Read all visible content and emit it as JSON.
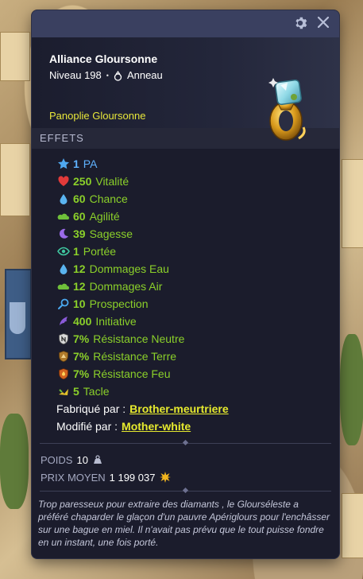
{
  "window": {
    "settings_icon": "gear-icon",
    "close_icon": "close-icon"
  },
  "item": {
    "name": "Alliance Gloursonne",
    "level": "Niveau 198",
    "separator": "•",
    "type": "Anneau",
    "set": "Panoplie Gloursonne"
  },
  "effects_title": "EFFETS",
  "effects": [
    {
      "value": "1",
      "label": "PA",
      "icon": "star-icon",
      "color": "#5fb2ff"
    },
    {
      "value": "250",
      "label": "Vitalité",
      "icon": "heart-icon",
      "color": "#8bd02a"
    },
    {
      "value": "60",
      "label": "Chance",
      "icon": "water-drop-icon",
      "color": "#8bd02a"
    },
    {
      "value": "60",
      "label": "Agilité",
      "icon": "air-cloud-icon",
      "color": "#8bd02a"
    },
    {
      "value": "39",
      "label": "Sagesse",
      "icon": "moon-icon",
      "color": "#8bd02a"
    },
    {
      "value": "1",
      "label": "Portée",
      "icon": "eye-icon",
      "color": "#8bd02a"
    },
    {
      "value": "12",
      "label": "Dommages Eau",
      "icon": "water-drop-icon",
      "color": "#8bd02a"
    },
    {
      "value": "12",
      "label": "Dommages Air",
      "icon": "air-cloud-icon",
      "color": "#8bd02a"
    },
    {
      "value": "10",
      "label": "Prospection",
      "icon": "magnifier-icon",
      "color": "#8bd02a"
    },
    {
      "value": "400",
      "label": "Initiative",
      "icon": "wing-icon",
      "color": "#8bd02a"
    },
    {
      "value": "7%",
      "label": "Résistance Neutre",
      "icon": "shield-neutral-icon",
      "color": "#8bd02a"
    },
    {
      "value": "7%",
      "label": "Résistance Terre",
      "icon": "shield-earth-icon",
      "color": "#8bd02a"
    },
    {
      "value": "7%",
      "label": "Résistance Feu",
      "icon": "shield-fire-icon",
      "color": "#8bd02a"
    },
    {
      "value": "5",
      "label": "Tacle",
      "icon": "tackle-icon",
      "color": "#8bd02a"
    }
  ],
  "crafted": {
    "label": "Fabriqué par :",
    "name": "Brother-meurtriere"
  },
  "modified": {
    "label": "Modifié par :",
    "name": "Mother-white"
  },
  "stats": {
    "weight_label": "POIDS",
    "weight_value": "10",
    "weight_icon": "weight-icon",
    "price_label": "PRIX MOYEN",
    "price_value": "1 199 037",
    "price_icon": "kamas-icon"
  },
  "description": "Trop paresseux pour extraire des diamants , le Glourséleste a préféré chaparder le glaçon d'un pauvre Apériglours pour l'enchâsser sur une bague en miel. Il n'avait pas prévu que le tout puisse fondre en un instant, une fois porté."
}
